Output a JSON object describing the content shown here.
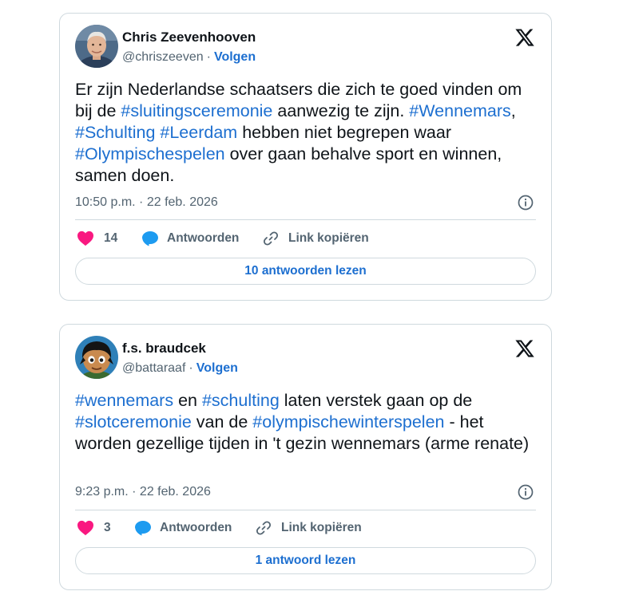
{
  "tweets": [
    {
      "author": {
        "display_name": "Chris Zeevenhooven",
        "handle": "@chriszeeven",
        "avatar_icon": "person-photo-avatar"
      },
      "follow_label": "Volgen",
      "text_segments": [
        {
          "t": "Er zijn Nederlandse schaatsers die zich te goed vinden om bij de  ",
          "tag": false
        },
        {
          "t": "#sluitingsceremonie",
          "tag": true
        },
        {
          "t": " aanwezig te zijn. ",
          "tag": false
        },
        {
          "t": "#Wennemars",
          "tag": true
        },
        {
          "t": ", ",
          "tag": false
        },
        {
          "t": "#Schulting",
          "tag": true
        },
        {
          "t": " ",
          "tag": false
        },
        {
          "t": "#Leerdam",
          "tag": true
        },
        {
          "t": " hebben niet begrepen waar ",
          "tag": false
        },
        {
          "t": "#Olympischespelen",
          "tag": true
        },
        {
          "t": " over gaan behalve sport en winnen, samen doen.",
          "tag": false
        }
      ],
      "timestamp": "10:50 p.m. · 22 feb. 2026",
      "likes": "14",
      "reply_label": "Antwoorden",
      "copy_link_label": "Link kopiëren",
      "read_replies_label": "10 antwoorden lezen"
    },
    {
      "author": {
        "display_name": "f.s. braudcek",
        "handle": "@battaraaf",
        "avatar_icon": "cartoon-character-avatar"
      },
      "follow_label": "Volgen",
      "text_segments": [
        {
          "t": "#wennemars",
          "tag": true
        },
        {
          "t": " en ",
          "tag": false
        },
        {
          "t": "#schulting",
          "tag": true
        },
        {
          "t": " laten verstek gaan op de ",
          "tag": false
        },
        {
          "t": "#slotceremonie",
          "tag": true
        },
        {
          "t": " van de ",
          "tag": false
        },
        {
          "t": "#olympischewinterspelen",
          "tag": true
        },
        {
          "t": " - het worden gezellige tijden in 't gezin wennemars (arme renate)",
          "tag": false
        }
      ],
      "timestamp": "9:23 p.m. · 22 feb. 2026",
      "likes": "3",
      "reply_label": "Antwoorden",
      "copy_link_label": "Link kopiëren",
      "read_replies_label": "1 antwoord lezen"
    }
  ],
  "colors": {
    "link": "#1d6fd0",
    "heart": "#f91880",
    "muted": "#536471",
    "border": "#cfd9de",
    "reply_bubble": "#1d9bf0"
  }
}
